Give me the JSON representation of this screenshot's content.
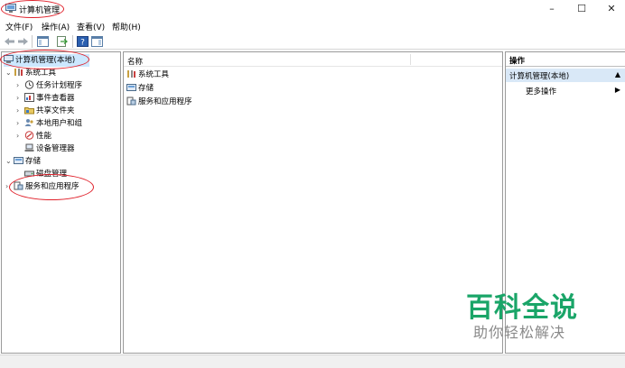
{
  "window": {
    "title": "计算机管理",
    "minimize": "–",
    "maximize": "☐",
    "close": "✕"
  },
  "menu": {
    "items": [
      "文件(F)",
      "操作(A)",
      "查看(V)",
      "帮助(H)"
    ]
  },
  "toolbar": {
    "icons": [
      "back-icon",
      "forward-icon",
      "show-tree-icon",
      "export-list-icon",
      "help-icon",
      "show-action-pane-icon"
    ]
  },
  "tree": {
    "root": "计算机管理(本地)",
    "system_tools": "系统工具",
    "task_scheduler": "任务计划程序",
    "event_viewer": "事件查看器",
    "shared_folders": "共享文件夹",
    "local_users": "本地用户和组",
    "performance": "性能",
    "device_manager": "设备管理器",
    "storage": "存储",
    "disk_management": "磁盘管理",
    "services_apps": "服务和应用程序",
    "expanded_glyph": "⌄",
    "collapsed_glyph": "›"
  },
  "list": {
    "column_name": "名称",
    "rows": [
      "系统工具",
      "存储",
      "服务和应用程序"
    ]
  },
  "actions": {
    "header": "操作",
    "title": "计算机管理(本地)",
    "title_arrow": "▲",
    "more": "更多操作",
    "more_arrow": "▶"
  },
  "watermark": {
    "big": "百科全说",
    "small": "助你轻松解决"
  },
  "colors": {
    "selection": "#cce8ff",
    "annotation": "#e0202a",
    "brand_green": "#1aa568"
  }
}
